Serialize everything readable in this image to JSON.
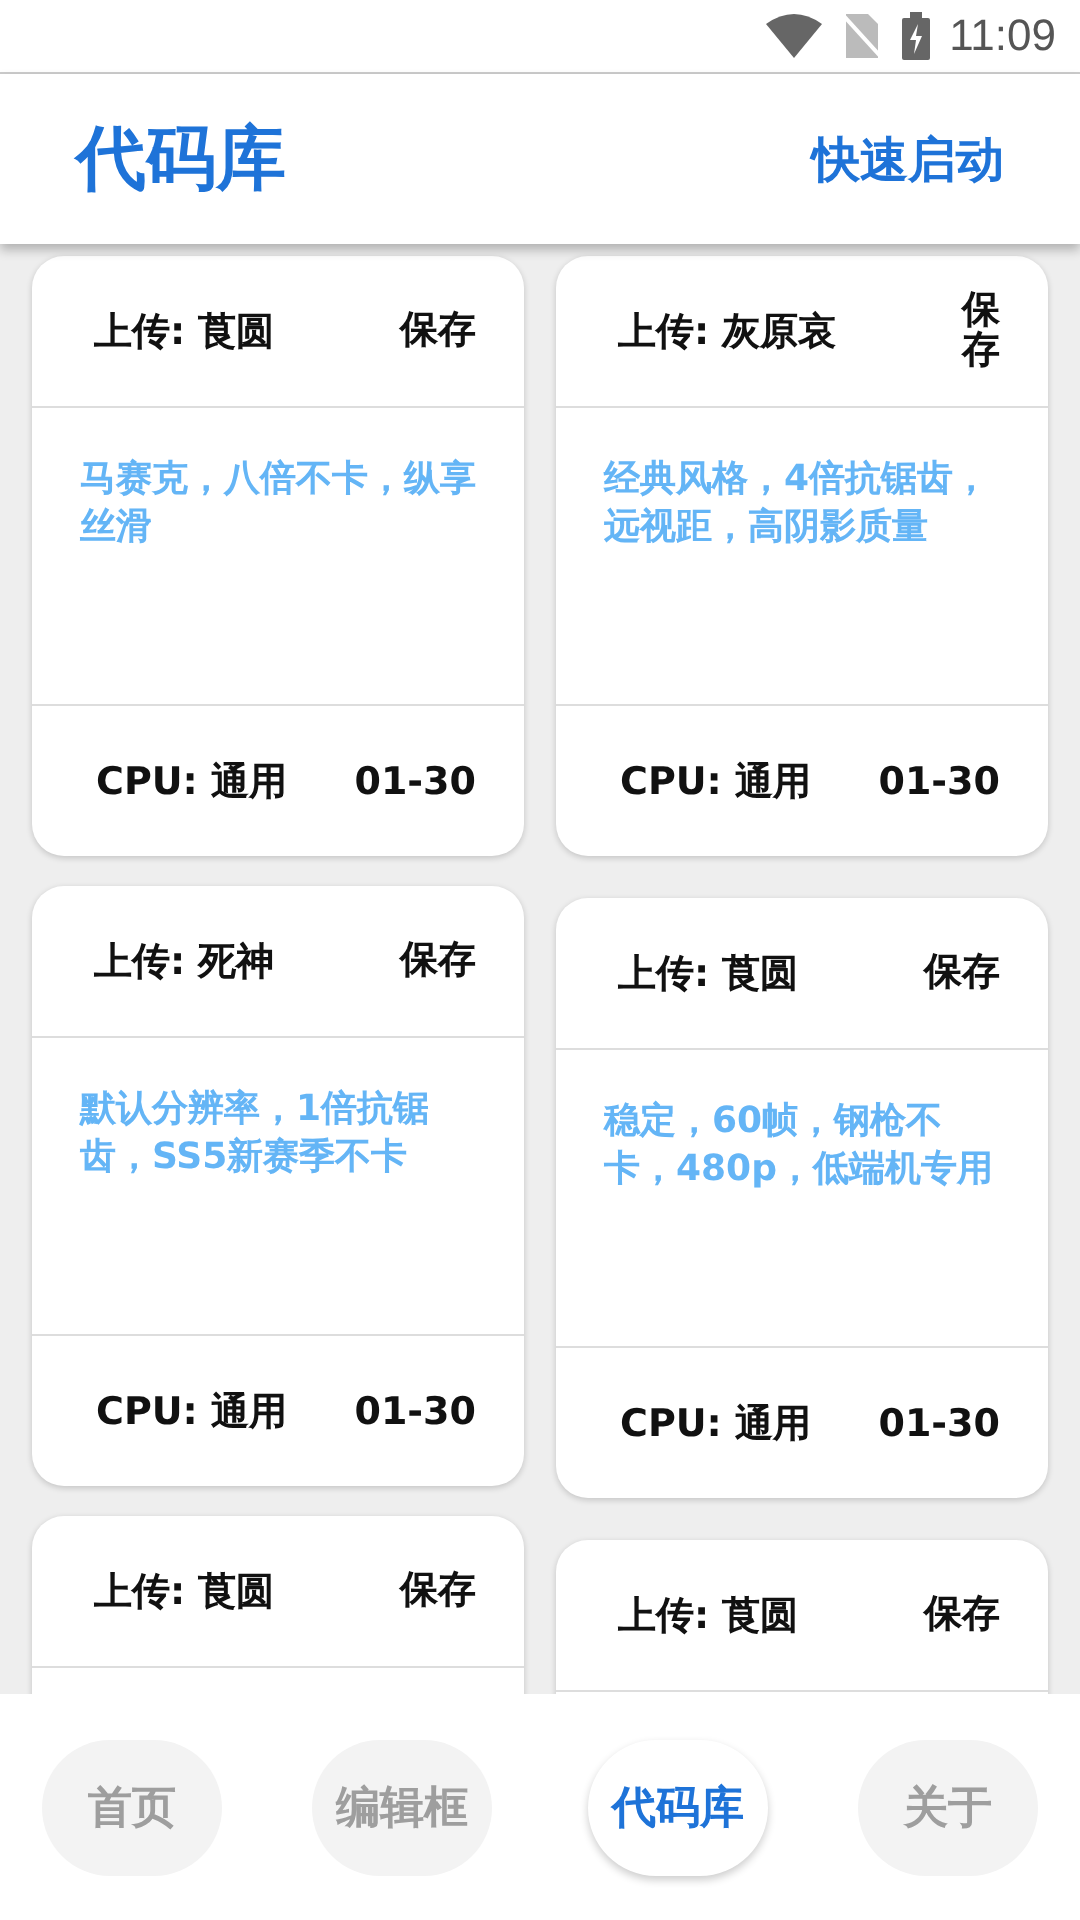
{
  "status_bar": {
    "time": "11:09"
  },
  "app_bar": {
    "title": "代码库",
    "action": "快速启动"
  },
  "columns": [
    {
      "cards": [
        {
          "uploader": "上传: 莨圆",
          "save": "保存",
          "description": "马赛克，八倍不卡，纵享丝滑",
          "cpu": "CPU: 通用",
          "date": "01-30"
        },
        {
          "uploader": "上传: 死神",
          "save": "保存",
          "description": "默认分辨率，1倍抗锯齿，SS5新赛季不卡",
          "cpu": "CPU: 通用",
          "date": "01-30"
        },
        {
          "uploader": "上传: 莨圆",
          "save": "保存"
        }
      ]
    },
    {
      "cards": [
        {
          "uploader": "上传: 灰原哀",
          "save": "保存",
          "description": "经典风格，4倍抗锯齿，远视距，高阴影质量",
          "cpu": "CPU: 通用",
          "date": "01-30"
        },
        {
          "uploader": "上传: 莨圆",
          "save": "保存",
          "description": "稳定，60帧，钢枪不卡，480p，低端机专用",
          "cpu": "CPU: 通用",
          "date": "01-30"
        },
        {
          "uploader": "上传: 莨圆",
          "save": "保存"
        }
      ]
    }
  ],
  "bottom_nav": [
    {
      "label": "首页",
      "selected": false
    },
    {
      "label": "编辑框",
      "selected": false
    },
    {
      "label": "代码库",
      "selected": true
    },
    {
      "label": "关于",
      "selected": false
    }
  ]
}
